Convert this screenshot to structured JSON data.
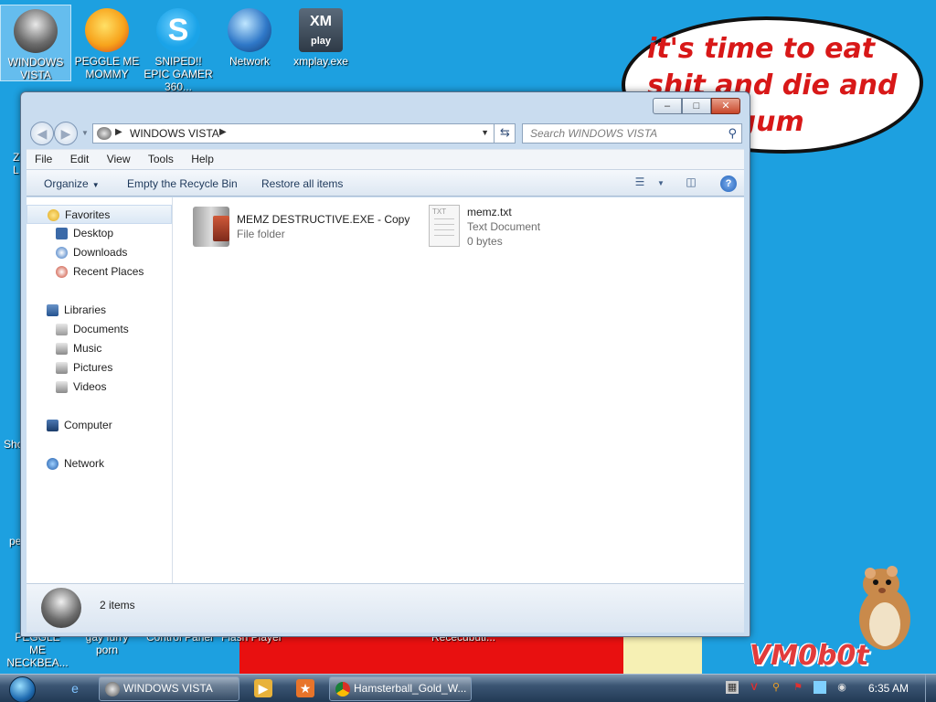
{
  "desktop": {
    "icons": [
      {
        "label": "WINDOWS VISTA",
        "icon": "vista-bin-icon"
      },
      {
        "label": "PEGGLE ME MOMMY",
        "icon": "peggle-icon"
      },
      {
        "label": "SNIPED!! EPIC GAMER 360...",
        "icon": "skype-icon"
      },
      {
        "label": "Network",
        "icon": "network-globe-icon"
      },
      {
        "label": "xmplay.exe",
        "icon": "xmplay-icon"
      }
    ],
    "edge_labels": [
      "Z",
      "L",
      "Sho",
      "pe",
      "PEGGLE ME NECKBEA...",
      "gay furry porn",
      "Control Panel",
      "Flash Player",
      "Rececubuti..."
    ],
    "bubble_text": "it's time to eat shit and die and chew gum",
    "watermark": "VM0b0t"
  },
  "window": {
    "title_buttons": {
      "minimize": "–",
      "maximize": "□",
      "close": "✕"
    },
    "address": {
      "crumb": "WINDOWS VISTA",
      "sep": "▶"
    },
    "search": {
      "placeholder": "Search WINDOWS VISTA"
    },
    "menu": [
      "File",
      "Edit",
      "View",
      "Tools",
      "Help"
    ],
    "commands": {
      "organize": "Organize",
      "empty": "Empty the Recycle Bin",
      "restore": "Restore all items"
    },
    "nav": [
      {
        "label": "Favorites",
        "icon": "star-icon",
        "level": 0
      },
      {
        "label": "Desktop",
        "icon": "desktop-icon",
        "level": 1
      },
      {
        "label": "Downloads",
        "icon": "downloads-icon",
        "level": 1
      },
      {
        "label": "Recent Places",
        "icon": "recent-places-icon",
        "level": 1
      },
      {
        "label": "Libraries",
        "icon": "libraries-icon",
        "level": 0
      },
      {
        "label": "Documents",
        "icon": "documents-icon",
        "level": 1
      },
      {
        "label": "Music",
        "icon": "music-icon",
        "level": 1
      },
      {
        "label": "Pictures",
        "icon": "pictures-icon",
        "level": 1
      },
      {
        "label": "Videos",
        "icon": "videos-icon",
        "level": 1
      },
      {
        "label": "Computer",
        "icon": "computer-icon",
        "level": 0
      },
      {
        "label": "Network",
        "icon": "network-icon",
        "level": 0
      }
    ],
    "files": [
      {
        "name": "MEMZ DESTRUCTIVE.EXE - Copy",
        "type": "File folder",
        "size": ""
      },
      {
        "name": "memz.txt",
        "type": "Text Document",
        "size": "0 bytes",
        "thumb": "TXT"
      }
    ],
    "status": {
      "items": "2 items"
    }
  },
  "taskbar": {
    "tasks": [
      {
        "label": "WINDOWS VISTA",
        "icon": "vista-bin-icon"
      },
      {
        "label": "Hamsterball_Gold_W...",
        "icon": "chrome-icon"
      }
    ],
    "clock": "6:35 AM",
    "colors": {
      "accent": "#1da0e0",
      "bubble_text": "#d81818",
      "taskbar": "#2a4362"
    }
  }
}
